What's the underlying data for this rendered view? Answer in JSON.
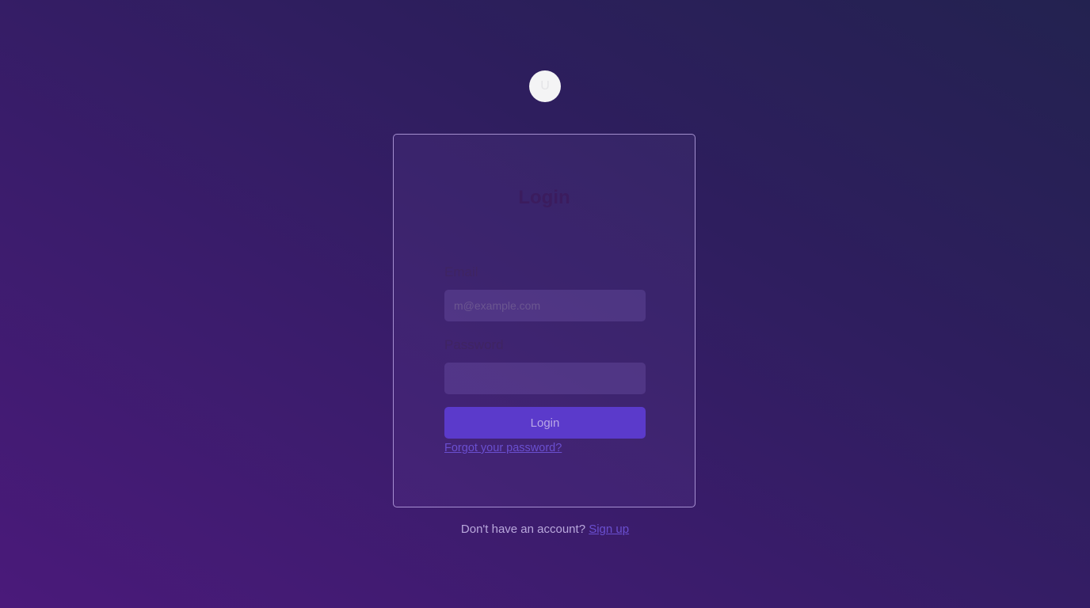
{
  "avatar": {
    "initial": "U",
    "background": "#f4f4f5"
  },
  "login_card": {
    "title": "Login",
    "email": {
      "label": "Email",
      "placeholder": "m@example.com",
      "value": ""
    },
    "password": {
      "label": "Password",
      "value": ""
    },
    "submit_label": "Login",
    "forgot_link": "Forgot your password?"
  },
  "footer": {
    "prompt": "Don't have an account?",
    "signup_link": "Sign up"
  },
  "colors": {
    "accent": "#5b3acb",
    "link": "#6a4fd0",
    "background_start": "#4a1a7a",
    "background_end": "#232250"
  }
}
